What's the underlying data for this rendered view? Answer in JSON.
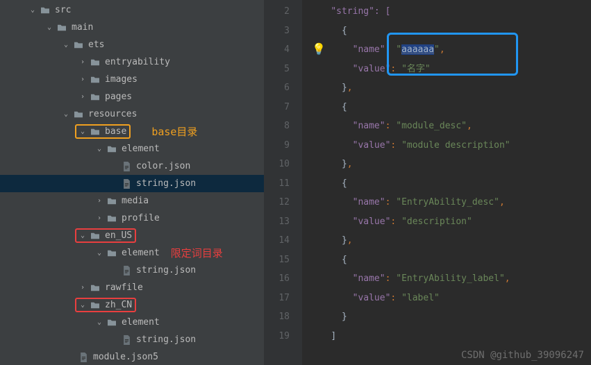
{
  "tree": {
    "src": "src",
    "main": "main",
    "ets": "ets",
    "entryability": "entryability",
    "images": "images",
    "pages": "pages",
    "resources": "resources",
    "base": "base",
    "element": "element",
    "color_json": "color.json",
    "string_json": "string.json",
    "media": "media",
    "profile": "profile",
    "en_US": "en_US",
    "rawfile": "rawfile",
    "zh_CN": "zh_CN",
    "module_json5": "module.json5"
  },
  "annotations": {
    "base_dir": "base目录",
    "qualifier_dir": "限定词目录"
  },
  "code": {
    "line2": "\"string\": [",
    "line3_open": "{",
    "l4_name_key": "\"name\"",
    "l4_name_val": "aaaaaa",
    "l5_value_key": "\"value\"",
    "l5_value_val": "\"名字\"",
    "l8_name_val": "\"module_desc\"",
    "l9_value_val": "\"module description\"",
    "l12_name_val": "\"EntryAbility_desc\"",
    "l13_value_val": "\"description\"",
    "l16_name_val": "\"EntryAbility_label\"",
    "l17_value_val": "\"label\"",
    "key_name": "\"name\"",
    "key_value": "\"value\""
  },
  "line_numbers": [
    "2",
    "3",
    "4",
    "5",
    "6",
    "7",
    "8",
    "9",
    "10",
    "11",
    "12",
    "13",
    "14",
    "15",
    "16",
    "17",
    "18",
    "19"
  ],
  "watermark": "CSDN @github_39096247",
  "chart_data": null
}
